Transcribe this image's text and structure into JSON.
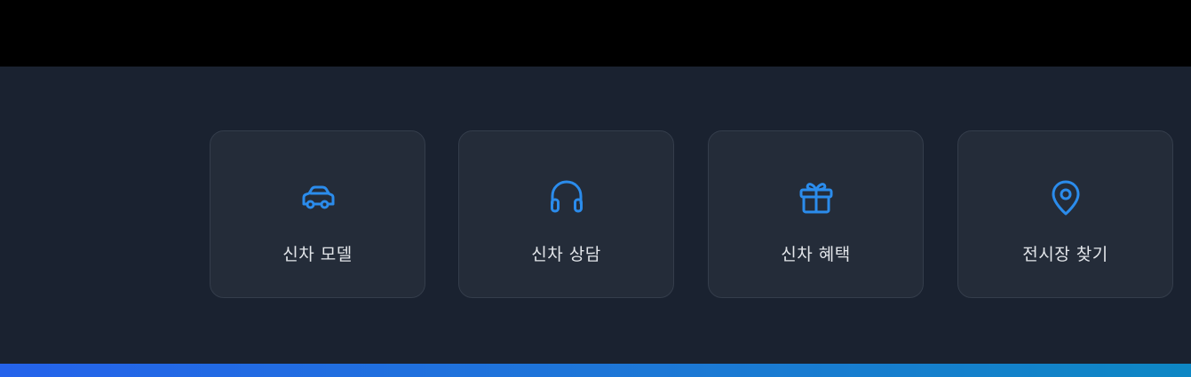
{
  "cards": [
    {
      "label": "신차 모델",
      "icon": "car-icon"
    },
    {
      "label": "신차 상담",
      "icon": "headphones-icon"
    },
    {
      "label": "신차 혜택",
      "icon": "gift-icon"
    },
    {
      "label": "전시장 찾기",
      "icon": "map-pin-icon"
    }
  ],
  "colors": {
    "accent": "#2b8cec",
    "section_background": "#1a2230",
    "card_background": "#242c39",
    "label_text": "#e3e6ea",
    "bottom_gradient_start": "#2563eb",
    "bottom_gradient_end": "#0e87c4"
  }
}
